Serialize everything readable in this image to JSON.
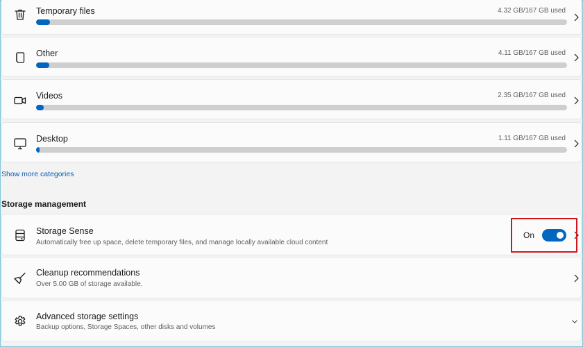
{
  "categories": [
    {
      "label": "Temporary files",
      "used": "4.32 GB/167 GB used",
      "fraction": 0.0259,
      "icon": "trash-icon"
    },
    {
      "label": "Other",
      "used": "4.11 GB/167 GB used",
      "fraction": 0.0246,
      "icon": "document-icon"
    },
    {
      "label": "Videos",
      "used": "2.35 GB/167 GB used",
      "fraction": 0.0141,
      "icon": "video-camera-icon"
    },
    {
      "label": "Desktop",
      "used": "1.11 GB/167 GB used",
      "fraction": 0.0066,
      "icon": "monitor-icon"
    }
  ],
  "show_more_label": "Show more categories",
  "storage_management": {
    "heading": "Storage management",
    "storage_sense": {
      "title": "Storage Sense",
      "subtitle": "Automatically free up space, delete temporary files, and manage locally available cloud content",
      "toggle_label": "On",
      "toggle_on": true,
      "icon": "drive-icon"
    },
    "cleanup": {
      "title": "Cleanup recommendations",
      "subtitle": "Over 5.00 GB of storage available.",
      "icon": "broom-icon"
    },
    "advanced": {
      "title": "Advanced storage settings",
      "subtitle": "Backup options, Storage Spaces, other disks and volumes",
      "icon": "gear-icon"
    }
  },
  "colors": {
    "accent": "#0067c0",
    "highlight_box": "#d0161c",
    "bar_track": "#cfcfcf",
    "link": "#0a5db3"
  }
}
